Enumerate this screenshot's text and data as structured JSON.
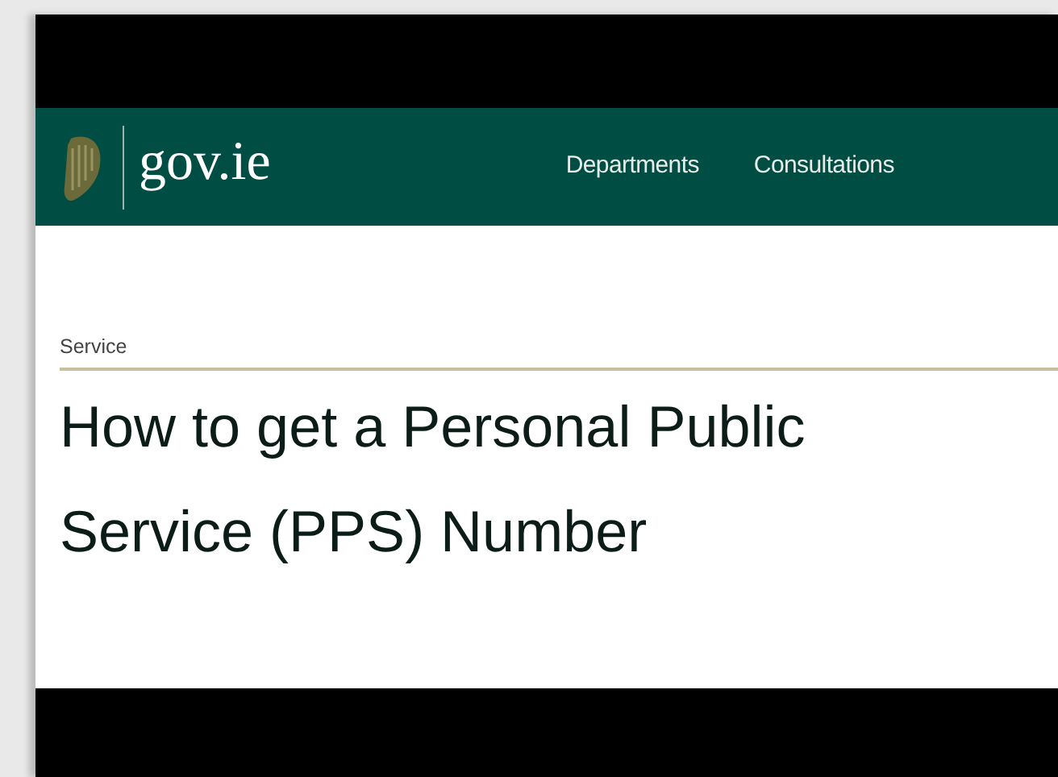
{
  "header": {
    "logo_text": "gov.ie",
    "nav": [
      {
        "label": "Departments"
      },
      {
        "label": "Consultations"
      }
    ]
  },
  "page": {
    "category": "Service",
    "title": "How to get a Personal Public Service (PPS) Number"
  }
}
